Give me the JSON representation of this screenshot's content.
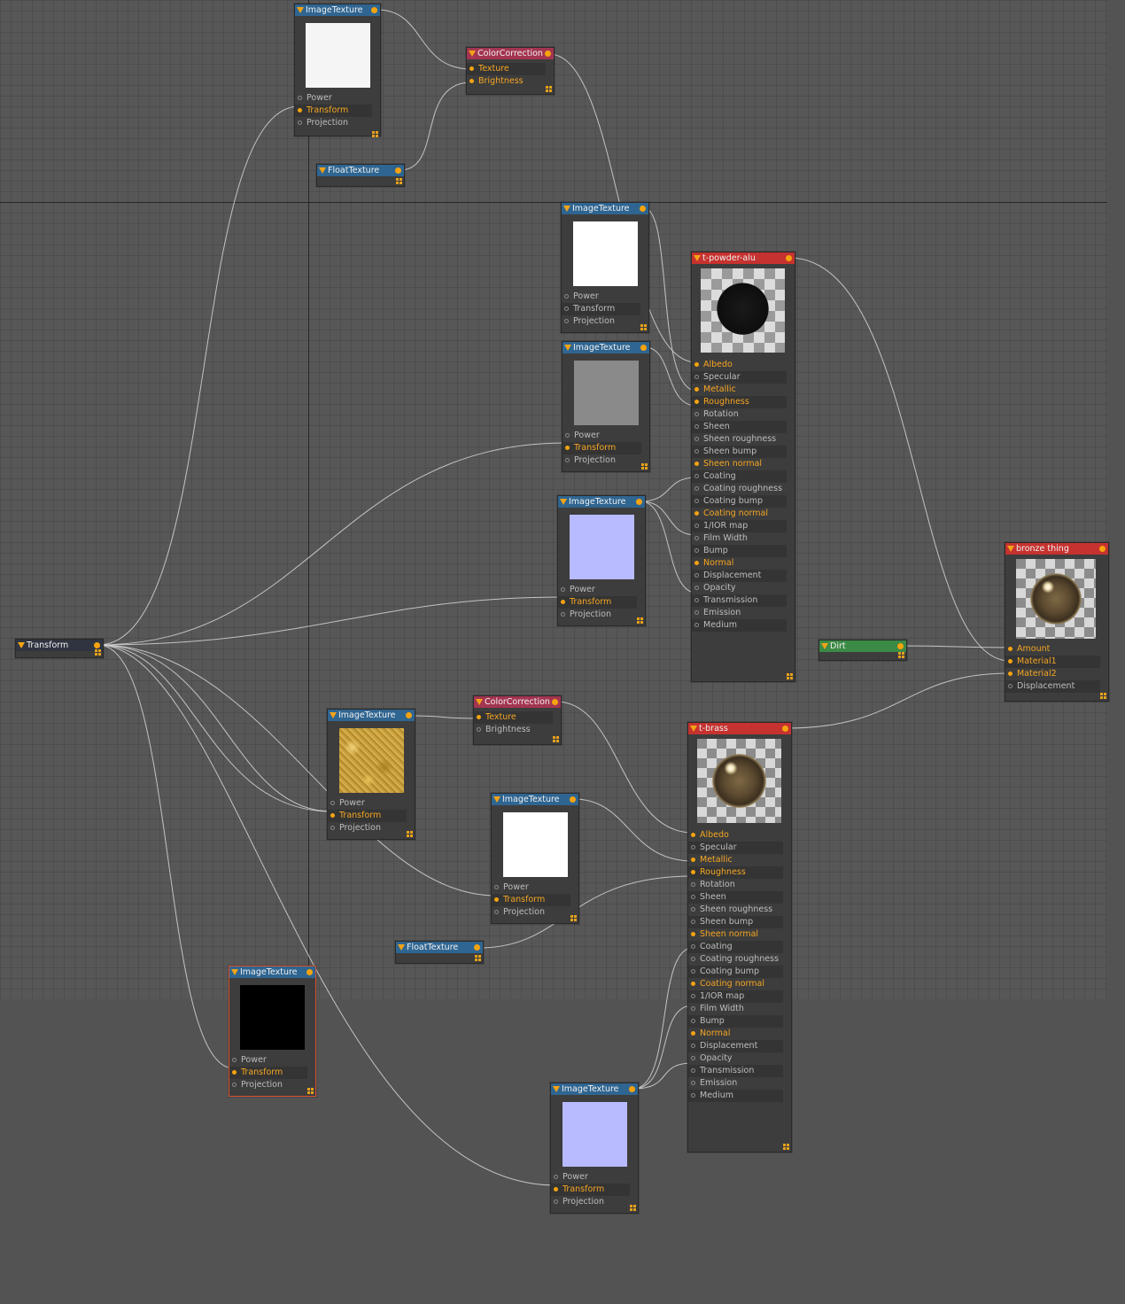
{
  "nodes": {
    "img_top": {
      "title": "ImageTexture",
      "swatch": "#f5f5f5",
      "inputs": [
        "Power",
        "Transform",
        "Projection"
      ]
    },
    "cc_top": {
      "title": "ColorCorrection",
      "inputs": [
        "Texture",
        "Brightness"
      ]
    },
    "float_top": {
      "title": "FloatTexture"
    },
    "img_white2": {
      "title": "ImageTexture",
      "swatch": "#ffffff",
      "inputs": [
        "Power",
        "Transform",
        "Projection"
      ]
    },
    "img_gray": {
      "title": "ImageTexture",
      "swatch": "#8a8a8a",
      "inputs": [
        "Power",
        "Transform",
        "Projection"
      ]
    },
    "img_normal1": {
      "title": "ImageTexture",
      "swatch": "#b8bbff",
      "inputs": [
        "Power",
        "Transform",
        "Projection"
      ]
    },
    "mat_alu": {
      "title": "t-powder-alu",
      "inputs": [
        "Albedo",
        "Specular",
        "Metallic",
        "Roughness",
        "Rotation",
        "Sheen",
        "Sheen roughness",
        "Sheen bump",
        "Sheen normal",
        "Coating",
        "Coating roughness",
        "Coating bump",
        "Coating normal",
        "1/IOR map",
        "Film Width",
        "Bump",
        "Normal",
        "Displacement",
        "Opacity",
        "Transmission",
        "Emission",
        "Medium"
      ]
    },
    "mix_bronze": {
      "title": "bronze thing",
      "inputs": [
        "Amount",
        "Material1",
        "Material2",
        "Displacement"
      ]
    },
    "dirt": {
      "title": "Dirt"
    },
    "transform": {
      "title": "Transform"
    },
    "img_sand": {
      "title": "ImageTexture",
      "inputs": [
        "Power",
        "Transform",
        "Projection"
      ]
    },
    "cc_mid": {
      "title": "ColorCorrection",
      "inputs": [
        "Texture",
        "Brightness"
      ]
    },
    "img_white3": {
      "title": "ImageTexture",
      "swatch": "#ffffff",
      "inputs": [
        "Power",
        "Transform",
        "Projection"
      ]
    },
    "float_mid": {
      "title": "FloatTexture"
    },
    "mat_brass": {
      "title": "t-brass",
      "inputs": [
        "Albedo",
        "Specular",
        "Metallic",
        "Roughness",
        "Rotation",
        "Sheen",
        "Sheen roughness",
        "Sheen bump",
        "Sheen normal",
        "Coating",
        "Coating roughness",
        "Coating bump",
        "Coating normal",
        "1/IOR map",
        "Film Width",
        "Bump",
        "Normal",
        "Displacement",
        "Opacity",
        "Transmission",
        "Emission",
        "Medium"
      ]
    },
    "img_black": {
      "title": "ImageTexture",
      "swatch": "#000000",
      "inputs": [
        "Power",
        "Transform",
        "Projection"
      ]
    },
    "img_normal2": {
      "title": "ImageTexture",
      "swatch": "#b8bbff",
      "inputs": [
        "Power",
        "Transform",
        "Projection"
      ]
    }
  },
  "colors": {
    "canvas": "#575757",
    "header_texture": "#2f6591",
    "header_material": "#c5322f",
    "header_correction": "#a33550",
    "header_dirt": "#3b8a45",
    "pin_active": "#f5a30f",
    "selected_border": "#d6522e"
  }
}
